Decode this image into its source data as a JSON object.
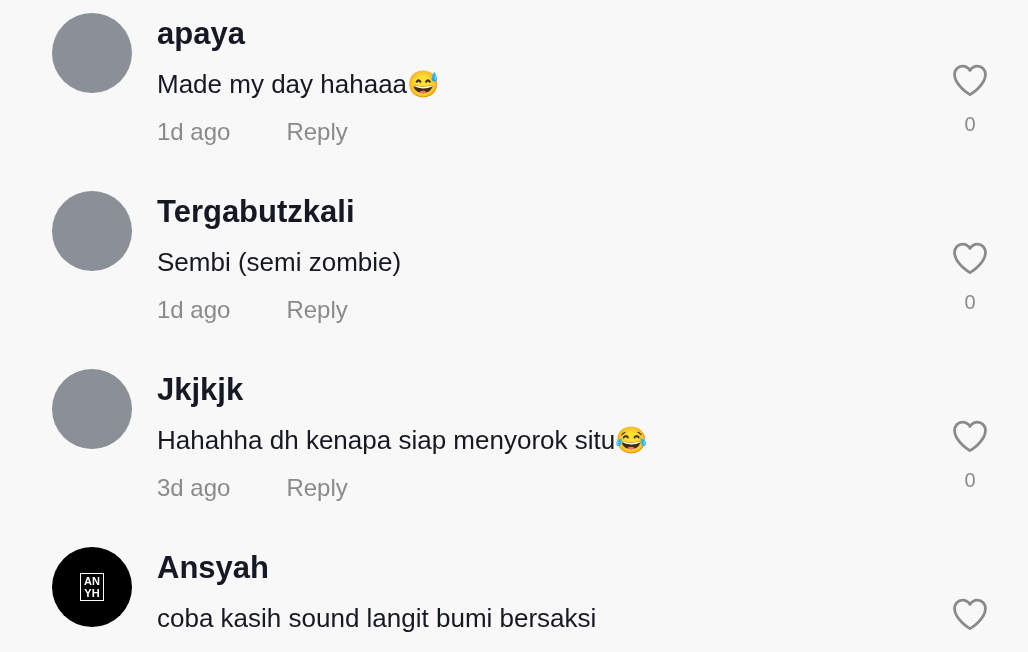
{
  "comments": [
    {
      "username": "apaya",
      "text": "Made my day hahaaa😅",
      "time": "1d ago",
      "reply": "Reply",
      "likes": "0",
      "avatar": {
        "kind": "photo"
      }
    },
    {
      "username": "Tergabutzkali",
      "text": "Sembi (semi zombie)",
      "time": "1d ago",
      "reply": "Reply",
      "likes": "0",
      "avatar": {
        "kind": "photo"
      }
    },
    {
      "username": "Jkjkjk",
      "text": "Hahahha dh kenapa siap menyorok situ😂",
      "time": "3d ago",
      "reply": "Reply",
      "likes": "0",
      "avatar": {
        "kind": "photo"
      }
    },
    {
      "username": "Ansyah",
      "text": "coba kasih sound langit bumi bersaksi",
      "avatar": {
        "kind": "logo",
        "lines": [
          "AN",
          "YH"
        ]
      }
    }
  ]
}
